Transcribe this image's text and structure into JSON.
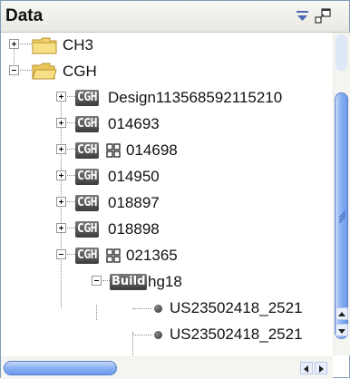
{
  "panel": {
    "title": "Data"
  },
  "tree": {
    "nodes": [
      {
        "label": "CH3",
        "icon": "folder-closed-icon",
        "expander": "plus"
      },
      {
        "label": "CGH",
        "icon": "folder-open-icon",
        "expander": "minus"
      },
      {
        "label": "Design113568592115210",
        "tag": "CGH",
        "expander": "plus"
      },
      {
        "label": "014693",
        "tag": "CGH",
        "expander": "plus"
      },
      {
        "label": "014698",
        "tag": "CGH",
        "grid": true,
        "expander": "plus"
      },
      {
        "label": "014950",
        "tag": "CGH",
        "expander": "plus"
      },
      {
        "label": "018897",
        "tag": "CGH",
        "expander": "plus"
      },
      {
        "label": "018898",
        "tag": "CGH",
        "expander": "plus"
      },
      {
        "label": "021365",
        "tag": "CGH",
        "grid": true,
        "expander": "minus"
      },
      {
        "label": "hg18",
        "tag": "Build",
        "expander": "minus"
      },
      {
        "label": "US23502418_2521",
        "icon": "bullet-icon"
      },
      {
        "label": "US23502418_2521",
        "icon": "bullet-icon"
      }
    ]
  },
  "colors": {
    "thumb": "#8fb4f3",
    "folder": "#f3d36b"
  }
}
